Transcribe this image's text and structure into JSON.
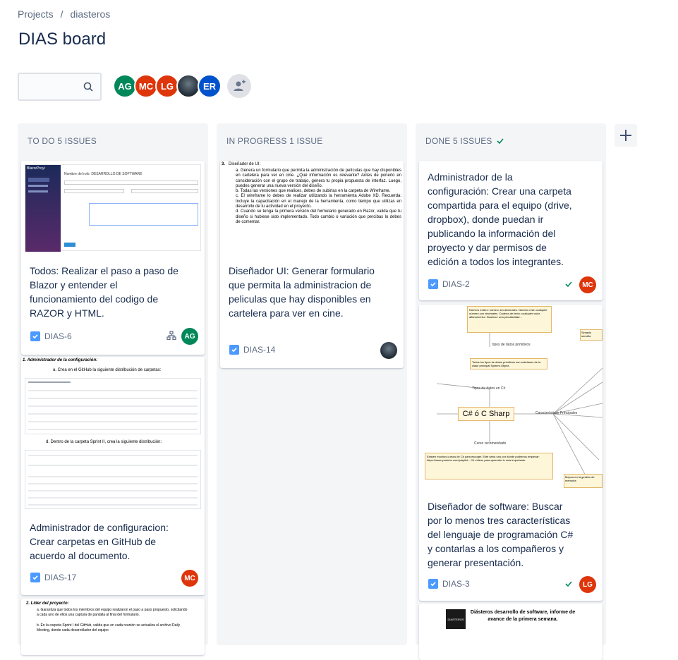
{
  "breadcrumb": {
    "projects": "Projects",
    "separator": "/",
    "project": "diasteros"
  },
  "board_title": "DIAS board",
  "search": {
    "placeholder": ""
  },
  "avatars": [
    {
      "initials": "AG",
      "color": "#00875a"
    },
    {
      "initials": "MC",
      "color": "#de350b"
    },
    {
      "initials": "LG",
      "color": "#de350b"
    },
    {
      "initials": "",
      "color": "#253858"
    },
    {
      "initials": "ER",
      "color": "#0052cc"
    }
  ],
  "columns": {
    "todo": {
      "label": "TO DO 5 ISSUES"
    },
    "inprogress": {
      "label": "IN PROGRESS 1 ISSUE"
    },
    "done": {
      "label": "DONE 5 ISSUES"
    }
  },
  "cards": {
    "dias6": {
      "text": "Todos: Realizar el paso a paso de Blazor y entender el funcionamiento del codigo de RAZOR y HTML.",
      "key": "DIAS-6",
      "assignee": "AG",
      "assignee_color": "#00875a"
    },
    "dias17": {
      "text": "Administrador de configuracion: Crear carpetas en GitHub de acuerdo al documento.",
      "key": "DIAS-17",
      "assignee": "MC",
      "assignee_color": "#de350b"
    },
    "dias14": {
      "text": "Diseñador UI: Generar formulario que permita la administracion de peliculas que hay disponibles en cartelera para ver en cine.",
      "key": "DIAS-14"
    },
    "dias2": {
      "text": "Administrador de la configuración: Crear una carpeta compartida para el equipo (drive, dropbox), donde puedan ir publicando la información del proyecto y dar permisos de edición a todos los integrantes.",
      "key": "DIAS-2",
      "assignee": "MC",
      "assignee_color": "#de350b"
    },
    "dias3": {
      "text": "Diseñador de software: Buscar por lo menos tres características del lenguaje de programación C# y contarlas a los compañeros y generar presentación.",
      "key": "DIAS-3",
      "assignee": "LG",
      "assignee_color": "#de350b"
    }
  },
  "attachments": {
    "dias14_doc": {
      "heading_num": "3.",
      "heading": "Diseñador de UI:",
      "items": [
        "a. Genera un formulario que permita la administración de películas que hay disponibles en cartelera para ver en cine. ¿Qué información es relevante? Antes de ponerlo en consideración con el grupo de trabajo, genera tu propia propuesta de interfaz. Luego, puedes generar una nueva versión del diseño.",
        "b. Todas las versiones que realices, debes de subirlas en la carpeta de Wireframe.",
        "c. El wireframe lo debes de realizar utilizando la herramienta Adobe XD. Recuerda: Incluye la capacitación en el manejo de la herramienta, como tiempo que utilizas en desarrollo de tu actividad en el proyecto.",
        "d. Cuando se tenga la primera versión del formulario generado en Razor, valida que tu diseño si hubiese sido implementado. Todo cambio o variación que percibas lo debes de comentar."
      ]
    },
    "dias17_doc": {
      "heading": "1.  Administrador de la configuración:",
      "step_a": "a.  Crea en el GitHub la siguiente distribución de carpetas:",
      "step_d": "d.  Dentro de la carpeta Sprint II, crea la siguiente distribución:"
    },
    "dias_next_doc": {
      "heading": "2.  Líder del proyecto:",
      "item_a": "a.  Garantiza que todos los miembros del equipo realizaron el paso a paso propuesto, solicitando a cada uno de ellos una captura de pantalla al final del formulario.",
      "item_b": "b.  En la carpeta Sprint I del GitHub, valida que en cada reunión se actualiza el archivo Daily Meeting, donde cada desarrollador del equipo"
    },
    "dias3_mindmap": {
      "center": "C# ó C Sharp",
      "top_note": "Número entero: número sin decimales. Número real: cualquier número con decimales. Cadena de texto: cualquier valor alfanumérico. Boolean: una peculiaridad...",
      "tipos_primitivos": "tipos de datos primitivos",
      "tipos_cs": "Tipos de datos en C#",
      "clase_system": "Todos los tipos de datos primitivos son subclases de la clase principal System.Object.",
      "curso": "Curso recomendado",
      "curso_text": "Existen muchos cursos de C# para escoger. Este sería uno por donde podemos empezar: https://www.youtube.com/playlist... C# vídeos para aprender lo más importante.",
      "caracteristicas": "Características Principales",
      "sintaxis": "Sintaxis sencilla",
      "mejora": "Mejora en la gestión de memoria"
    },
    "next_done_doc": {
      "title": "Diásteros desarrollo de software, informe de avance de la primera semana.",
      "logo": "DIASTEROS"
    },
    "dias6_screenshot": {
      "app": "BlazorProyi",
      "form_title": "Nombre del rolo: DESARROLLO DE SOFTWARE"
    }
  }
}
